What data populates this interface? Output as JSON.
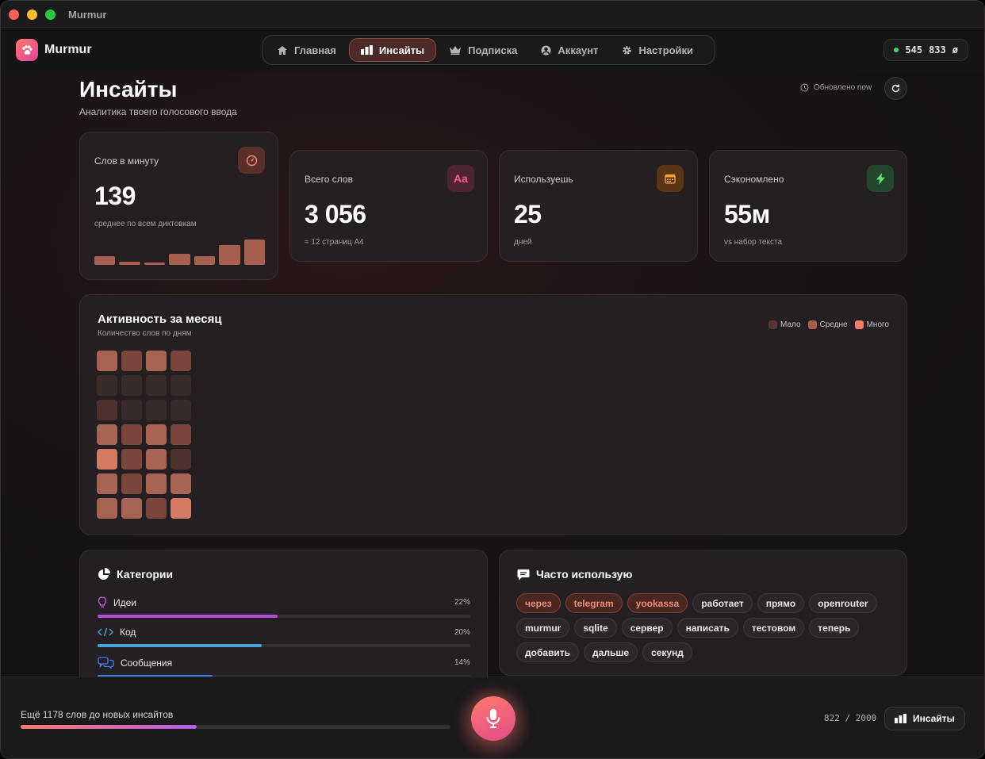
{
  "window": {
    "title": "Murmur"
  },
  "brand": {
    "name": "Murmur"
  },
  "nav": [
    {
      "label": "Главная",
      "icon": "home-icon",
      "active": false
    },
    {
      "label": "Инсайты",
      "icon": "bar-chart-icon",
      "active": true
    },
    {
      "label": "Подписка",
      "icon": "crown-icon",
      "active": false
    },
    {
      "label": "Аккаунт",
      "icon": "user-circle-icon",
      "active": false
    },
    {
      "label": "Настройки",
      "icon": "gear-icon",
      "active": false
    }
  ],
  "counter": {
    "left": "545",
    "right": "833",
    "symbol": "ø",
    "status_color": "#3ddc6a"
  },
  "page": {
    "title": "Инсайты",
    "subtitle": "Аналитика твоего голосового ввода",
    "updated": "Обновлено now"
  },
  "stats": [
    {
      "label": "Слов в минуту",
      "value": "139",
      "note": "среднее по всем диктовкам",
      "icon": "speedometer-icon",
      "icon_color": "#f08b74",
      "icon_bg": "#5a2f2a"
    },
    {
      "label": "Всего слов",
      "value": "3 056",
      "note": "≈ 12 страниц A4",
      "icon": "text-aa-icon",
      "icon_text": "Aa",
      "icon_color": "#ff5c8a",
      "icon_bg": "#4e2433"
    },
    {
      "label": "Используешь",
      "value": "25",
      "note": "дней",
      "icon": "calendar-icon",
      "icon_color": "#f4a340",
      "icon_bg": "#5a3414"
    },
    {
      "label": "Сэкономлено",
      "value": "55м",
      "note": "vs набор текста",
      "icon": "lightning-icon",
      "icon_color": "#5ee07a",
      "icon_bg": "#23472c"
    }
  ],
  "mini_bars": [
    0.32,
    0.12,
    0.1,
    0.42,
    0.32,
    0.74,
    0.95
  ],
  "activity": {
    "title": "Активность за месяц",
    "subtitle": "Количество слов по дням",
    "legend": [
      {
        "label": "Мало",
        "color": "#5a3432"
      },
      {
        "label": "Средне",
        "color": "#a65d4c"
      },
      {
        "label": "Много",
        "color": "#ef7d62"
      }
    ],
    "cells": [
      3,
      2,
      3,
      2,
      0,
      0,
      0,
      0,
      1,
      0,
      0,
      0,
      3,
      2,
      3,
      2,
      4,
      2,
      3,
      1,
      3,
      2,
      3,
      3,
      3,
      3,
      2,
      4
    ],
    "cell_colors": [
      "#3a2b2b",
      "#4b302d",
      "#7a453b",
      "#a86452",
      "#d27a62"
    ]
  },
  "categories": {
    "title": "Категории",
    "items": [
      {
        "name": "Идеи",
        "pct": "22%",
        "icon": "lightbulb-icon",
        "color": "#b44ad8",
        "value": 0.22
      },
      {
        "name": "Код",
        "pct": "20%",
        "icon": "code-icon",
        "color": "#4ba3d6",
        "value": 0.2
      },
      {
        "name": "Сообщения",
        "pct": "14%",
        "icon": "chat-bubbles-icon",
        "color": "#3b82f6",
        "value": 0.14
      }
    ]
  },
  "frequent": {
    "title": "Часто использую",
    "tags": [
      {
        "text": "через",
        "hot": true
      },
      {
        "text": "telegram",
        "hot": true
      },
      {
        "text": "yookassa",
        "hot": true
      },
      {
        "text": "работает",
        "hot": false
      },
      {
        "text": "прямо",
        "hot": false
      },
      {
        "text": "openrouter",
        "hot": false
      },
      {
        "text": "murmur",
        "hot": false
      },
      {
        "text": "sqlite",
        "hot": false
      },
      {
        "text": "сервер",
        "hot": false
      },
      {
        "text": "написать",
        "hot": false
      },
      {
        "text": "тестовом",
        "hot": false
      },
      {
        "text": "теперь",
        "hot": false
      },
      {
        "text": "добавить",
        "hot": false
      },
      {
        "text": "дальше",
        "hot": false
      },
      {
        "text": "секунд",
        "hot": false
      }
    ]
  },
  "footer": {
    "more_text": "Ещё 1178 слов до новых инсайтов",
    "progress": 0.41,
    "progress_text": "822 / 2000",
    "button_label": "Инсайты"
  }
}
